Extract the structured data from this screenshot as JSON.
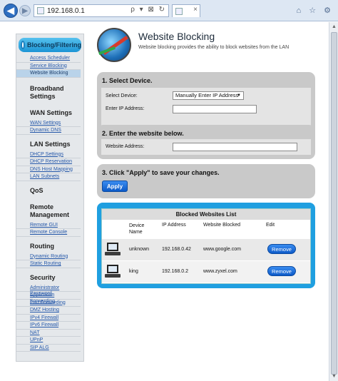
{
  "browser": {
    "url": "192.168.0.1",
    "address_tools": "ρ ▾ ⊠ ↻",
    "tab_close": "×",
    "right_tools": "⌂ ☆ ⚙"
  },
  "sidebar": {
    "active": "Blocking/Filtering",
    "sections": [
      {
        "title": "",
        "items": [
          "Access Scheduler",
          "Service Blocking",
          "Website Blocking"
        ]
      },
      {
        "title": "Broadband Settings",
        "items": []
      },
      {
        "title": "WAN Settings",
        "items": [
          "WAN Settings",
          "Dynamic DNS"
        ]
      },
      {
        "title": "LAN Settings",
        "items": [
          "DHCP Settings",
          "DHCP Reservation",
          "DNS Host Mapping",
          "LAN Subnets"
        ]
      },
      {
        "title": "QoS",
        "items": []
      },
      {
        "title": "Remote Management",
        "items": [
          "Remote GUI",
          "Remote Console"
        ]
      },
      {
        "title": "Routing",
        "items": [
          "Dynamic Routing",
          "Static Routing"
        ]
      },
      {
        "title": "Security",
        "items": [
          "Administrator Password",
          "Application Forwarding",
          "Port Forwarding",
          "DMZ Hosting",
          "IPv4 Firewall",
          "IPv6 Firewall",
          "NAT",
          "UPnP",
          "SIP ALG"
        ]
      }
    ]
  },
  "header": {
    "title": "Website Blocking",
    "description": "Website blocking provides the ability to block websites from the LAN"
  },
  "step1": {
    "heading": "1. Select Device.",
    "device_label": "Select Device:",
    "device_value": "Manually Enter IP Address",
    "ip_label": "Enter IP Address:",
    "ip_value": ""
  },
  "step2": {
    "heading": "2. Enter the website below.",
    "website_label": "Website Address:",
    "website_value": ""
  },
  "step3": {
    "heading": "3. Click \"Apply\" to save your changes.",
    "apply_label": "Apply"
  },
  "blocked": {
    "title": "Blocked Websites List",
    "columns": [
      "Device Name",
      "IP Address",
      "Website Blocked",
      "Edit"
    ],
    "rows": [
      {
        "device": "unknown",
        "ip": "192.168.0.42",
        "website": "www.google.com",
        "action": "Remove"
      },
      {
        "device": "king",
        "ip": "192.168.0.2",
        "website": "www.zyxel.com",
        "action": "Remove"
      }
    ]
  },
  "colors": {
    "accent": "#1f9fe0",
    "panel": "#c9c9c9",
    "link": "#2356a8"
  }
}
